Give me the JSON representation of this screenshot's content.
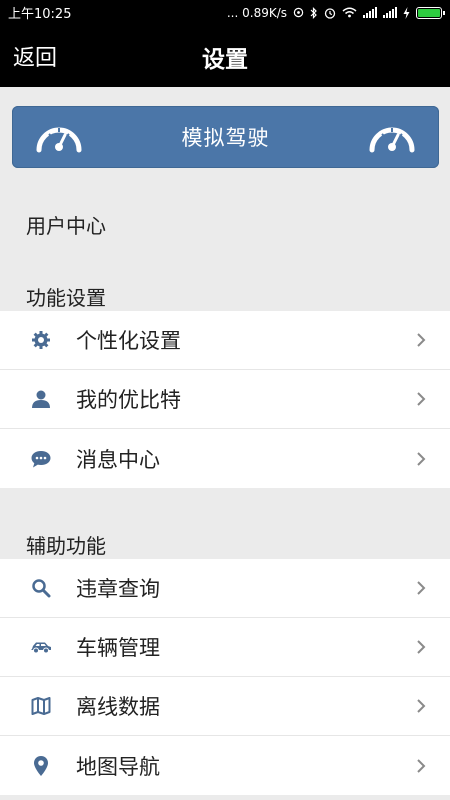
{
  "status_bar": {
    "time": "上午10:25",
    "network_speed": "... 0.89K/s",
    "icons": [
      "alarm-icon",
      "bluetooth-icon",
      "clock-icon",
      "wifi-icon",
      "signal-icon",
      "signal-icon",
      "charging-icon",
      "battery-icon"
    ]
  },
  "header": {
    "back_label": "返回",
    "title": "设置"
  },
  "banner": {
    "label": "模拟驾驶",
    "left_icon": "speedometer-icon",
    "right_icon": "speedometer-icon",
    "color": "#4b76a8"
  },
  "sections": {
    "user_center": "用户中心",
    "function_settings": "功能设置",
    "auxiliary": "辅助功能"
  },
  "function_items": [
    {
      "label": "个性化设置",
      "icon": "gear-icon"
    },
    {
      "label": "我的优比特",
      "icon": "user-icon"
    },
    {
      "label": "消息中心",
      "icon": "chat-bubble-icon"
    }
  ],
  "aux_items": [
    {
      "label": "违章查询",
      "icon": "search-icon"
    },
    {
      "label": "车辆管理",
      "icon": "car-icon"
    },
    {
      "label": "离线数据",
      "icon": "map-icon"
    },
    {
      "label": "地图导航",
      "icon": "location-pin-icon"
    }
  ],
  "colors": {
    "accent": "#4b76a8",
    "icon": "#4a6b93",
    "background": "#ebebeb"
  }
}
